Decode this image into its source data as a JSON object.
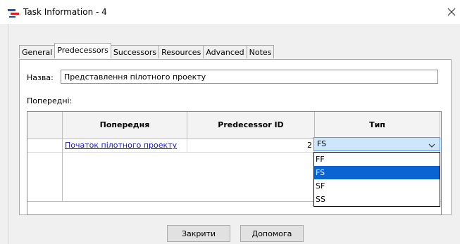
{
  "window": {
    "title": "Task Information - 4",
    "icon": "gantt-chart-icon",
    "close_icon": "close-icon"
  },
  "tabs": [
    {
      "label": "General",
      "active": false
    },
    {
      "label": "Predecessors",
      "active": true
    },
    {
      "label": "Successors",
      "active": false
    },
    {
      "label": "Resources",
      "active": false
    },
    {
      "label": "Advanced",
      "active": false
    },
    {
      "label": "Notes",
      "active": false
    }
  ],
  "form": {
    "name_label": "Назва:",
    "name_value": "Представлення пілотного проекту",
    "predecessors_label": "Попередні:"
  },
  "table": {
    "columns": [
      "Попередня",
      "Predecessor ID",
      "Тип"
    ],
    "rows": [
      {
        "predecessor": "Початок пілотного проекту",
        "predecessor_id": "2",
        "type": "FS"
      }
    ]
  },
  "type_dropdown": {
    "selected": "FS",
    "options": [
      "FF",
      "FS",
      "SF",
      "SS"
    ],
    "highlighted": "FS"
  },
  "buttons": {
    "close": "Закрити",
    "help": "Допомога"
  },
  "colors": {
    "link": "#1a1ad0",
    "selection": "#0a64d2",
    "dropdown_bg": "#cde6fa"
  }
}
